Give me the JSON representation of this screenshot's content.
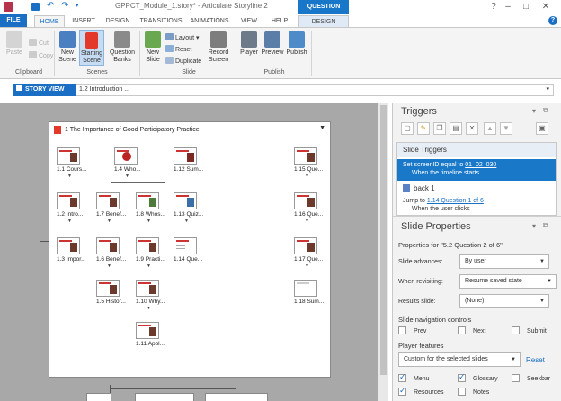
{
  "window": {
    "title": "GPPCT_Module_1.story* - Articulate Storyline 2",
    "contextual_tab_group": "QUESTION TOOLS"
  },
  "tabs": [
    "FILE",
    "HOME",
    "INSERT",
    "DESIGN",
    "TRANSITIONS",
    "ANIMATIONS",
    "VIEW",
    "HELP",
    "DESIGN"
  ],
  "ribbon": {
    "clipboard": {
      "paste": "Paste",
      "cut": "Cut",
      "copy": "Copy",
      "label": "Clipboard"
    },
    "scenes": {
      "new_scene": "New Scene",
      "starting_scene": "Starting Scene",
      "question_banks": "Question Banks",
      "label": "Scenes"
    },
    "slide": {
      "new_slide": "New Slide",
      "layout": "Layout",
      "reset": "Reset",
      "duplicate": "Duplicate",
      "record_screen": "Record Screen",
      "label": "Slide"
    },
    "publish": {
      "player": "Player",
      "preview": "Preview",
      "publish": "Publish",
      "label": "Publish"
    }
  },
  "story_view": {
    "tab_label": "STORY VIEW",
    "breadcrumb": "1.2 Introduction ..."
  },
  "scene": {
    "title": "1 The Importance of Good Participatory Practice",
    "slides": [
      {
        "label": "1.1 Cours..."
      },
      {
        "label": "1.4 Who..."
      },
      {
        "label": "1.12 Sum..."
      },
      {
        "label": "1.15 Que..."
      },
      {
        "label": "1.2 Intro..."
      },
      {
        "label": "1.7 Benef..."
      },
      {
        "label": "1.8 Whos..."
      },
      {
        "label": "1.13 Quiz..."
      },
      {
        "label": "1.16 Que..."
      },
      {
        "label": "1.3 Impor..."
      },
      {
        "label": "1.6 Benef..."
      },
      {
        "label": "1.9 Practi..."
      },
      {
        "label": "1.14 Que..."
      },
      {
        "label": "1.17 Que..."
      },
      {
        "label": "1.5 Histor..."
      },
      {
        "label": "1.10 Why..."
      },
      {
        "label": "1.18 Sum..."
      },
      {
        "label": "1.11 Appl..."
      }
    ]
  },
  "triggers": {
    "title": "Triggers",
    "section": "Slide Triggers",
    "selected": {
      "line1_prefix": "Set screenID equal to ",
      "line1_link": "01_02_030",
      "line2": "When the timeline starts"
    },
    "item2": {
      "name": "back 1",
      "jump_prefix": "Jump to ",
      "jump_link": "1.14 Question 1 of 6",
      "when": "When the user clicks"
    }
  },
  "slide_properties": {
    "title": "Slide Properties",
    "properties_for": "Properties for \"5.2 Question 2 of 6\"",
    "slide_advances_label": "Slide advances:",
    "slide_advances_value": "By user",
    "when_revisiting_label": "When revisiting:",
    "when_revisiting_value": "Resume saved state",
    "results_slide_label": "Results slide:",
    "results_slide_value": "(None)",
    "nav_heading": "Slide navigation controls",
    "nav": {
      "prev": "Prev",
      "next": "Next",
      "submit": "Submit"
    },
    "player_heading": "Player features",
    "player_value": "Custom for the selected slides",
    "reset": "Reset",
    "features": {
      "menu": "Menu",
      "glossary": "Glossary",
      "seekbar": "Seekbar",
      "resources": "Resources",
      "notes": "Notes"
    }
  }
}
